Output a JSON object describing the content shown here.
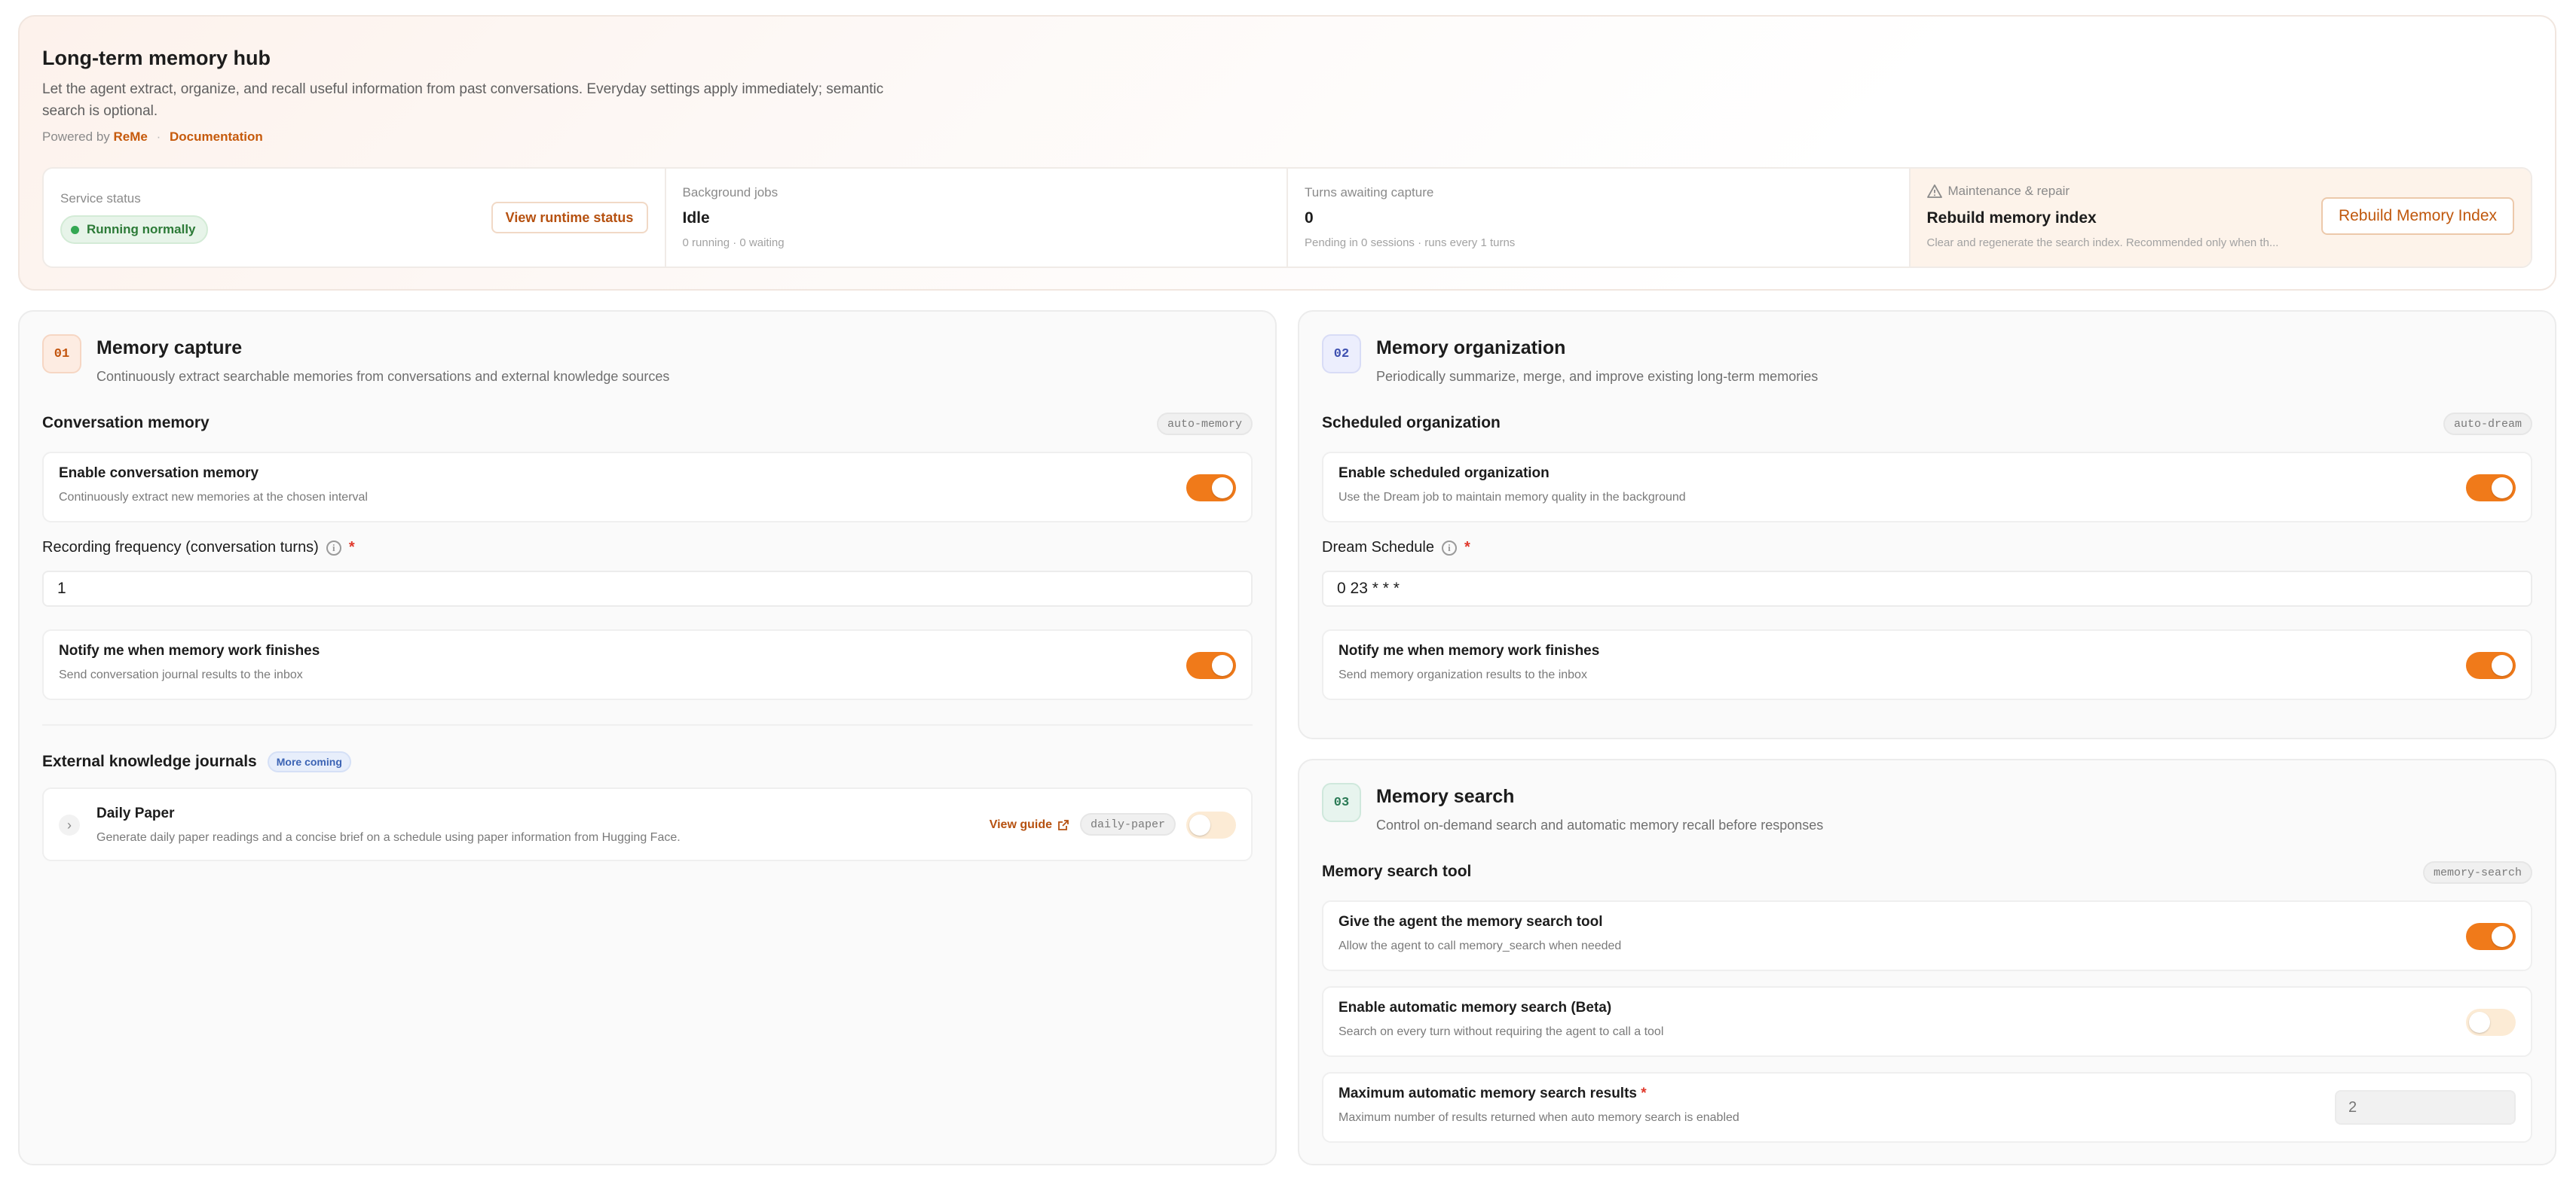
{
  "hero": {
    "title": "Long-term memory hub",
    "description": "Let the agent extract, organize, and recall useful information from past conversations. Everyday settings apply immediately; semantic search is optional.",
    "powered_by": "Powered by",
    "reme_link": "ReMe",
    "separator": "·",
    "docs_link": "Documentation"
  },
  "status": {
    "service": {
      "label": "Service status",
      "pill": "Running normally",
      "button": "View runtime status"
    },
    "jobs": {
      "label": "Background jobs",
      "value": "Idle",
      "sub": "0 running · 0 waiting"
    },
    "turns": {
      "label": "Turns awaiting capture",
      "value": "0",
      "sub": "Pending in 0 sessions · runs every 1 turns"
    },
    "maintenance": {
      "label": "Maintenance & repair",
      "title": "Rebuild memory index",
      "sub": "Clear and regenerate the search index. Recommended only when th...",
      "button": "Rebuild Memory Index"
    }
  },
  "capture": {
    "num": "01",
    "title": "Memory capture",
    "subtitle": "Continuously extract searchable memories from conversations and external knowledge sources",
    "section_title": "Conversation memory",
    "section_tag": "auto-memory",
    "enable": {
      "title": "Enable conversation memory",
      "sub": "Continuously extract new memories at the chosen interval",
      "on": true
    },
    "frequency_label": "Recording frequency (conversation turns)",
    "required_mark": "*",
    "frequency_value": "1",
    "notify": {
      "title": "Notify me when memory work finishes",
      "sub": "Send conversation journal results to the inbox",
      "on": true
    },
    "external_title": "External knowledge journals",
    "external_pill": "More coming",
    "daily": {
      "title": "Daily Paper",
      "sub": "Generate daily paper readings and a concise brief on a schedule using paper information from Hugging Face.",
      "guide": "View guide",
      "tag": "daily-paper",
      "on": false
    }
  },
  "organization": {
    "num": "02",
    "title": "Memory organization",
    "subtitle": "Periodically summarize, merge, and improve existing long-term memories",
    "section_title": "Scheduled organization",
    "section_tag": "auto-dream",
    "enable": {
      "title": "Enable scheduled organization",
      "sub": "Use the Dream job to maintain memory quality in the background",
      "on": true
    },
    "schedule_label": "Dream Schedule",
    "required_mark": "*",
    "schedule_value": "0 23 * * *",
    "notify": {
      "title": "Notify me when memory work finishes",
      "sub": "Send memory organization results to the inbox",
      "on": true
    }
  },
  "search": {
    "num": "03",
    "title": "Memory search",
    "subtitle": "Control on-demand search and automatic memory recall before responses",
    "section_title": "Memory search tool",
    "section_tag": "memory-search",
    "tool": {
      "title": "Give the agent the memory search tool",
      "sub": "Allow the agent to call memory_search when needed",
      "on": true
    },
    "auto": {
      "title": "Enable automatic memory search (Beta)",
      "sub": "Search on every turn without requiring the agent to call a tool",
      "on": false
    },
    "max": {
      "title": "Maximum automatic memory search results",
      "required_mark": "*",
      "sub": "Maximum number of results returned when auto memory search is enabled",
      "placeholder": "2"
    }
  },
  "colors": {
    "accent": "#f07a1a",
    "link": "#c65a0c",
    "success": "#34a853",
    "required": "#e0382b"
  }
}
